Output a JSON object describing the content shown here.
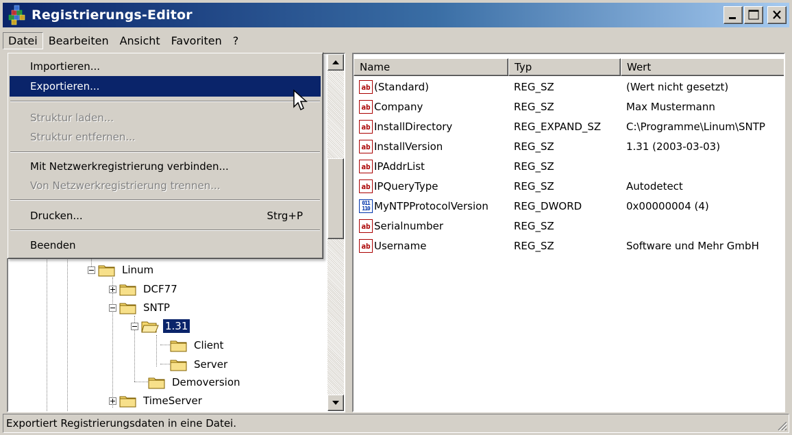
{
  "window": {
    "title": "Registrierungs-Editor"
  },
  "menubar": [
    "Datei",
    "Bearbeiten",
    "Ansicht",
    "Favoriten",
    "?"
  ],
  "dropdown": {
    "items": [
      {
        "label": "Importieren...",
        "enabled": true
      },
      {
        "label": "Exportieren...",
        "enabled": true,
        "highlighted": true
      },
      {
        "label": "Struktur laden...",
        "enabled": false
      },
      {
        "label": "Struktur entfernen...",
        "enabled": false
      },
      {
        "label": "Mit Netzwerkregistrierung verbinden...",
        "enabled": true
      },
      {
        "label": "Von Netzwerkregistrierung trennen...",
        "enabled": false
      },
      {
        "label": "Drucken...",
        "shortcut": "Strg+P",
        "enabled": true
      },
      {
        "label": "Beenden",
        "enabled": true
      }
    ]
  },
  "tree": {
    "nodes": [
      {
        "label": "Linum",
        "expanded": true
      },
      {
        "label": "DCF77",
        "expanded": false
      },
      {
        "label": "SNTP",
        "expanded": true
      },
      {
        "label": "1.31",
        "expanded": true,
        "selected": true
      },
      {
        "label": "Client"
      },
      {
        "label": "Server"
      },
      {
        "label": "Demoversion"
      },
      {
        "label": "TimeServer",
        "expanded": false
      }
    ]
  },
  "list": {
    "columns": [
      "Name",
      "Typ",
      "Wert"
    ],
    "rows": [
      {
        "icon": "string-value-icon",
        "name": "(Standard)",
        "type": "REG_SZ",
        "value": "(Wert nicht gesetzt)"
      },
      {
        "icon": "string-value-icon",
        "name": "Company",
        "type": "REG_SZ",
        "value": "Max Mustermann"
      },
      {
        "icon": "string-value-icon",
        "name": "InstallDirectory",
        "type": "REG_EXPAND_SZ",
        "value": "C:\\Programme\\Linum\\SNTP"
      },
      {
        "icon": "string-value-icon",
        "name": "InstallVersion",
        "type": "REG_SZ",
        "value": "1.31 (2003-03-03)"
      },
      {
        "icon": "string-value-icon",
        "name": "IPAddrList",
        "type": "REG_SZ",
        "value": ""
      },
      {
        "icon": "string-value-icon",
        "name": "IPQueryType",
        "type": "REG_SZ",
        "value": "Autodetect"
      },
      {
        "icon": "binary-value-icon",
        "name": "MyNTPProtocolVersion",
        "type": "REG_DWORD",
        "value": "0x00000004 (4)"
      },
      {
        "icon": "string-value-icon",
        "name": "Serialnumber",
        "type": "REG_SZ",
        "value": ""
      },
      {
        "icon": "string-value-icon",
        "name": "Username",
        "type": "REG_SZ",
        "value": "Software und Mehr GmbH"
      }
    ]
  },
  "statusbar": {
    "text": "Exportiert Registrierungsdaten in eine Datei."
  },
  "icons": {
    "string": "ab",
    "binary": "011\n110"
  },
  "colors": {
    "titlebar_start": "#0a246a",
    "titlebar_end": "#a6caf0",
    "highlight": "#0a246a",
    "chrome": "#d4d0c8"
  }
}
